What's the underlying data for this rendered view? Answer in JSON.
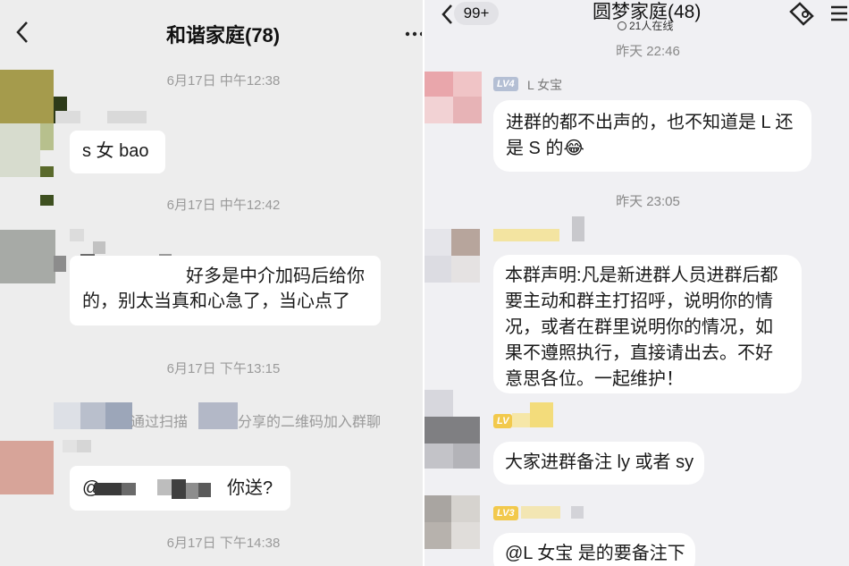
{
  "left": {
    "header": {
      "title": "和谐家庭(78)",
      "back_icon": "chevron-left-icon",
      "more_icon": "more-dots-icon"
    },
    "messages": [
      {
        "type": "time",
        "text": "6月17日 中午12:38"
      },
      {
        "type": "bubble",
        "text": "s 女 bao"
      },
      {
        "type": "time",
        "text": "6月17日 中午12:42"
      },
      {
        "type": "bubble",
        "line1": "好多是中介加码后给你",
        "line2": "的，别太当真和心急了，当心点了"
      },
      {
        "type": "time",
        "text": "6月17日 下午13:15"
      },
      {
        "type": "system",
        "part1": "通过扫描",
        "part2": "分享的二维码加入群聊"
      },
      {
        "type": "bubble",
        "prefix": "@",
        "text": "你送?"
      },
      {
        "type": "time",
        "text": "6月17日 下午14:38"
      }
    ]
  },
  "right": {
    "header": {
      "title": "圆梦家庭(48)",
      "badge": "99+",
      "online": "21人在线",
      "back_icon": "chevron-left-icon",
      "action_icon": "settings-icon"
    },
    "messages": [
      {
        "type": "time",
        "text": "昨天 22:46"
      },
      {
        "type": "sender",
        "level": "LV4",
        "name": "L 女宝"
      },
      {
        "type": "bubble",
        "line1": "进群的都不出声的，也不知道是 L 还",
        "line2": "是 S 的😂"
      },
      {
        "type": "time",
        "text": "昨天 23:05"
      },
      {
        "type": "bubble",
        "line1": "本群声明:凡是新进群人员进群后都",
        "line2": "要主动和群主打招呼，说明你的情",
        "line3": "况，或者在群里说明你的情况，如",
        "line4": "果不遵照执行，直接请出去。不好",
        "line5": "意思各位。一起维护！"
      },
      {
        "type": "sender",
        "level": "LV"
      },
      {
        "type": "bubble",
        "text": "大家进群备注 ly 或者 sy"
      },
      {
        "type": "sender",
        "level": "LV3"
      },
      {
        "type": "bubble",
        "text": "@L 女宝  是的要备注下"
      }
    ],
    "colors": {
      "lv4": "#b4bfd4",
      "lv3": "#f2c94c",
      "bubble": "#ffffff"
    }
  }
}
